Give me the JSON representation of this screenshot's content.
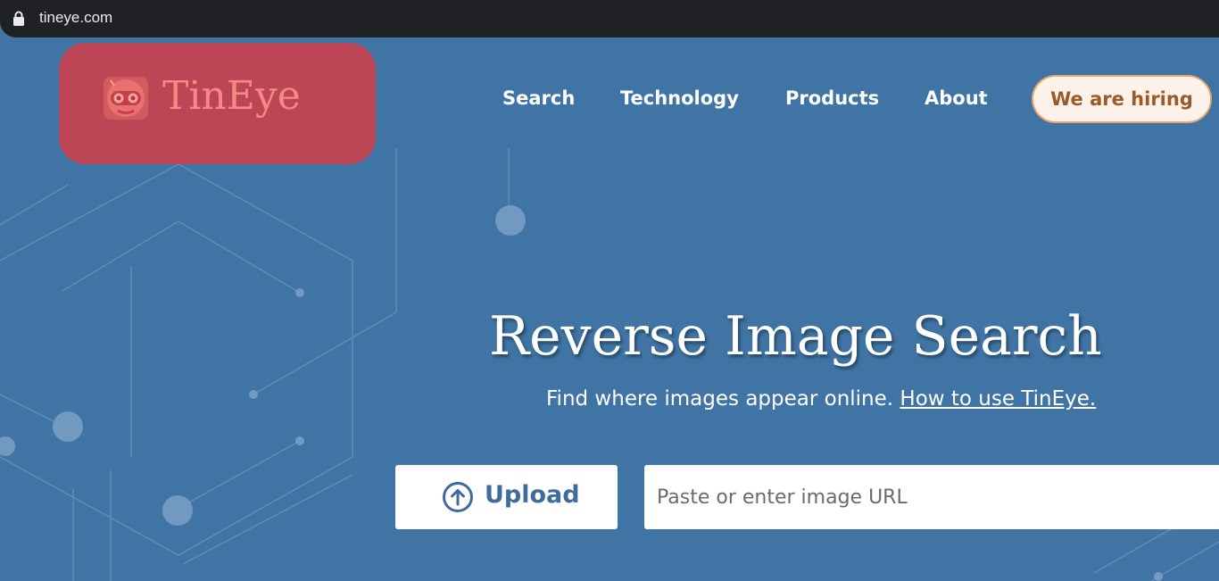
{
  "browser": {
    "url": "tineye.com"
  },
  "brand": {
    "name": "TinEye"
  },
  "nav": {
    "items": [
      "Search",
      "Technology",
      "Products",
      "About"
    ],
    "hiring_label": "We are hiring"
  },
  "hero": {
    "title": "Reverse Image Search",
    "subtitle": "Find where images appear online.",
    "how_to_link": "How to use TinEye."
  },
  "search": {
    "upload_label": "Upload",
    "url_placeholder": "Paste or enter image URL"
  },
  "colors": {
    "background": "#3f74a4",
    "logo_block": "#bd4656",
    "hiring_button": "#fdf2e9",
    "upload_text": "#3f6b9e"
  },
  "icons": {
    "lock": "lock-icon",
    "upload": "upload-arrow-icon",
    "mascot": "tineye-robot-icon"
  }
}
